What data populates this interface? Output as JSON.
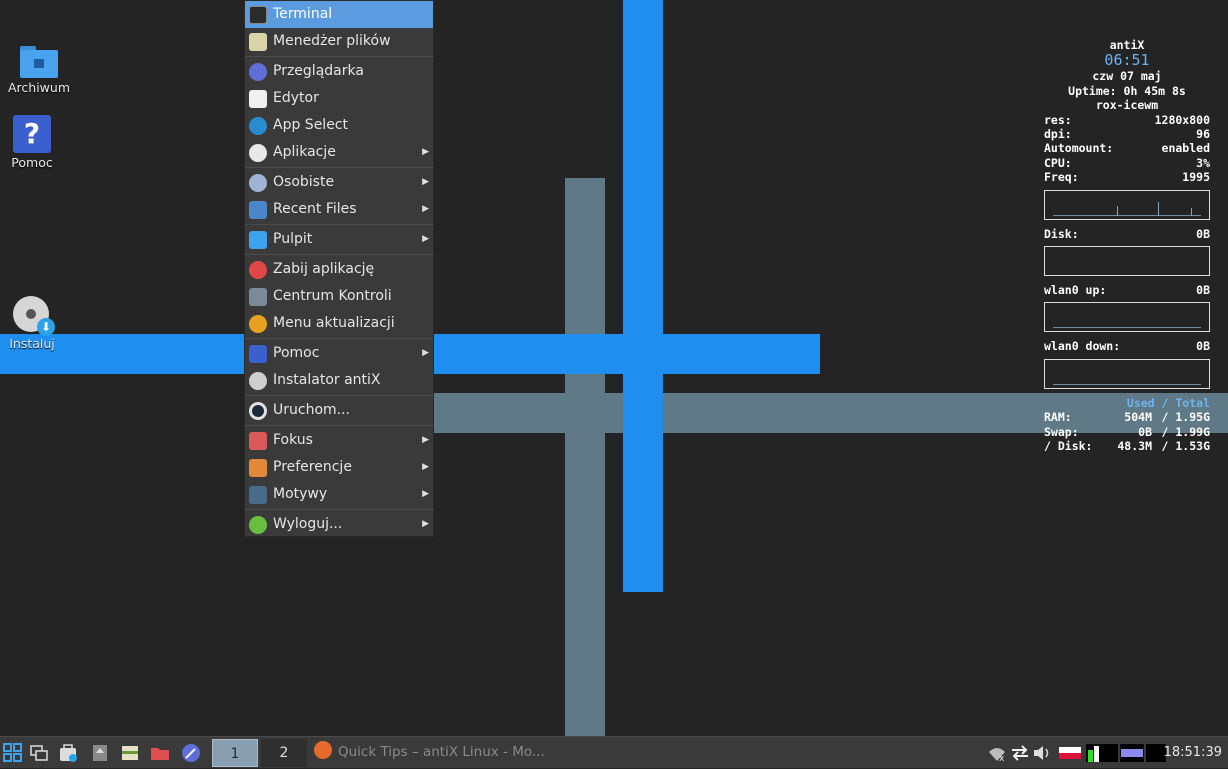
{
  "desktop": {
    "icons": [
      {
        "label": "Archiwum"
      },
      {
        "label": "Pomoc"
      },
      {
        "label": "Instaluj"
      }
    ]
  },
  "menu": {
    "items": [
      {
        "label": "Terminal",
        "icon": "terminal-icon",
        "submenu": false
      },
      {
        "label": "Menedżer plików",
        "icon": "file-manager-icon",
        "submenu": false
      },
      {
        "label": "Przeglądarka",
        "icon": "browser-icon",
        "submenu": false
      },
      {
        "label": "Edytor",
        "icon": "editor-icon",
        "submenu": false
      },
      {
        "label": "App Select",
        "icon": "app-select-icon",
        "submenu": false
      },
      {
        "label": "Aplikacje",
        "icon": "apps-grid-icon",
        "submenu": true
      },
      {
        "label": "Osobiste",
        "icon": "user-icon",
        "submenu": true
      },
      {
        "label": "Recent Files",
        "icon": "recent-folder-icon",
        "submenu": true
      },
      {
        "label": "Pulpit",
        "icon": "desktop-icon",
        "submenu": true
      },
      {
        "label": "Zabij aplikację",
        "icon": "kill-icon",
        "submenu": false
      },
      {
        "label": "Centrum Kontroli",
        "icon": "control-centre-icon",
        "submenu": false
      },
      {
        "label": "Menu aktualizacji",
        "icon": "update-icon",
        "submenu": false
      },
      {
        "label": "Pomoc",
        "icon": "help-icon",
        "submenu": true
      },
      {
        "label": "Instalator antiX",
        "icon": "installer-icon",
        "submenu": false
      },
      {
        "label": "Uruchom...",
        "icon": "run-icon",
        "submenu": false
      },
      {
        "label": "Fokus",
        "icon": "focus-icon",
        "submenu": true
      },
      {
        "label": "Preferencje",
        "icon": "preferences-icon",
        "submenu": true
      },
      {
        "label": "Motywy",
        "icon": "themes-icon",
        "submenu": true
      },
      {
        "label": "Wyloguj...",
        "icon": "logout-icon",
        "submenu": true
      }
    ],
    "arrow": "▶"
  },
  "conky": {
    "title": "antiX",
    "time": "06:51",
    "date": "czw 07 maj",
    "uptime": "Uptime: 0h 45m 8s",
    "wm": "rox-icewm",
    "stats": [
      {
        "label": "res:",
        "value": "1280x800"
      },
      {
        "label": "dpi:",
        "value": "96"
      },
      {
        "label": "Automount:",
        "value": "enabled"
      },
      {
        "label": "CPU:",
        "value": "3%"
      },
      {
        "label": "Freq:",
        "value": "1995"
      }
    ],
    "disk": {
      "label": "Disk:",
      "value": "0B"
    },
    "wlan_up": {
      "label": "wlan0 up:",
      "value": "0B"
    },
    "wlan_down": {
      "label": "wlan0 down:",
      "value": "0B"
    },
    "used_total": "Used / Total",
    "memory": [
      {
        "label": "RAM:",
        "used": "504M",
        "total": "/ 1.95G"
      },
      {
        "label": "Swap:",
        "used": "0B",
        "total": "/ 1.99G"
      },
      {
        "label": "/ Disk:",
        "used": "48.3M",
        "total": "/ 1.53G"
      }
    ]
  },
  "taskbar": {
    "workspaces": [
      "1",
      "2"
    ],
    "task_title": "Quick Tips – antiX Linux - Mo...",
    "clock": "18:51:39",
    "colors": {
      "active_workspace": "#8aa0b0",
      "accent": "#1e8ff0"
    }
  }
}
